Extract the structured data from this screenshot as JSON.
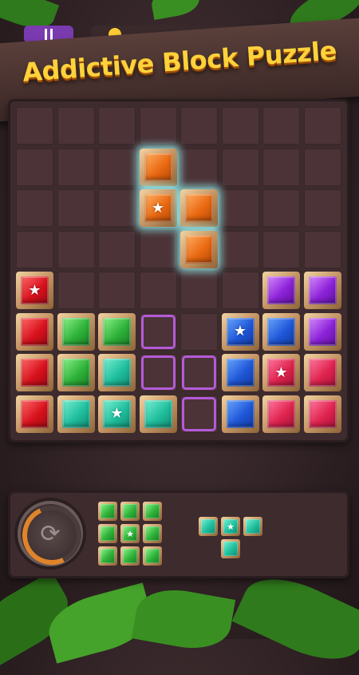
{
  "banner": {
    "title": "Addictive Block Puzzle"
  },
  "top_bar": {
    "pause_icon": "pause-icon",
    "score_icon": "coin-icon"
  },
  "colors": {
    "accent": "#ffd23a",
    "board": "#3d2b2e",
    "hint_outline": "#b45ad8",
    "glow": "#a0ffff"
  },
  "board": {
    "rows": 8,
    "cols": 8,
    "gems": [
      {
        "row": 1,
        "col": 3,
        "color": "orange",
        "star": false,
        "glow": true
      },
      {
        "row": 2,
        "col": 3,
        "color": "orange",
        "star": true,
        "glow": true
      },
      {
        "row": 2,
        "col": 4,
        "color": "orange",
        "star": false,
        "glow": true
      },
      {
        "row": 3,
        "col": 4,
        "color": "orange",
        "star": false,
        "glow": true
      },
      {
        "row": 4,
        "col": 0,
        "color": "red",
        "star": true
      },
      {
        "row": 4,
        "col": 6,
        "color": "purple",
        "star": false
      },
      {
        "row": 4,
        "col": 7,
        "color": "purple",
        "star": false
      },
      {
        "row": 5,
        "col": 0,
        "color": "red",
        "star": false
      },
      {
        "row": 5,
        "col": 1,
        "color": "green",
        "star": false
      },
      {
        "row": 5,
        "col": 2,
        "color": "green",
        "star": false
      },
      {
        "row": 5,
        "col": 5,
        "color": "blue",
        "star": true
      },
      {
        "row": 5,
        "col": 6,
        "color": "blue",
        "star": false
      },
      {
        "row": 5,
        "col": 7,
        "color": "purple",
        "star": false
      },
      {
        "row": 6,
        "col": 0,
        "color": "red",
        "star": false
      },
      {
        "row": 6,
        "col": 1,
        "color": "green",
        "star": false
      },
      {
        "row": 6,
        "col": 2,
        "color": "teal",
        "star": false
      },
      {
        "row": 6,
        "col": 5,
        "color": "blue",
        "star": false
      },
      {
        "row": 6,
        "col": 6,
        "color": "pink",
        "star": true
      },
      {
        "row": 6,
        "col": 7,
        "color": "pink",
        "star": false
      },
      {
        "row": 7,
        "col": 0,
        "color": "red",
        "star": false
      },
      {
        "row": 7,
        "col": 1,
        "color": "teal",
        "star": false
      },
      {
        "row": 7,
        "col": 2,
        "color": "teal",
        "star": true
      },
      {
        "row": 7,
        "col": 3,
        "color": "teal",
        "star": false
      },
      {
        "row": 7,
        "col": 5,
        "color": "blue",
        "star": false
      },
      {
        "row": 7,
        "col": 6,
        "color": "pink",
        "star": false
      },
      {
        "row": 7,
        "col": 7,
        "color": "pink",
        "star": false
      }
    ],
    "hints": [
      {
        "row": 5,
        "col": 3
      },
      {
        "row": 6,
        "col": 3
      },
      {
        "row": 6,
        "col": 4
      },
      {
        "row": 7,
        "col": 4
      }
    ]
  },
  "tray": {
    "rotate_icon": "rotate-icon",
    "pieces": [
      {
        "color": "green",
        "cells": [
          [
            0,
            0
          ],
          [
            0,
            1
          ],
          [
            0,
            2
          ],
          [
            1,
            0
          ],
          [
            1,
            1
          ],
          [
            1,
            2
          ],
          [
            2,
            0
          ],
          [
            2,
            1
          ],
          [
            2,
            2
          ]
        ],
        "star_cell": [
          1,
          1
        ]
      },
      {
        "color": "teal",
        "cells": [
          [
            0,
            0
          ],
          [
            0,
            1
          ],
          [
            0,
            2
          ],
          [
            1,
            1
          ]
        ],
        "star_cell": [
          0,
          1
        ]
      }
    ]
  }
}
